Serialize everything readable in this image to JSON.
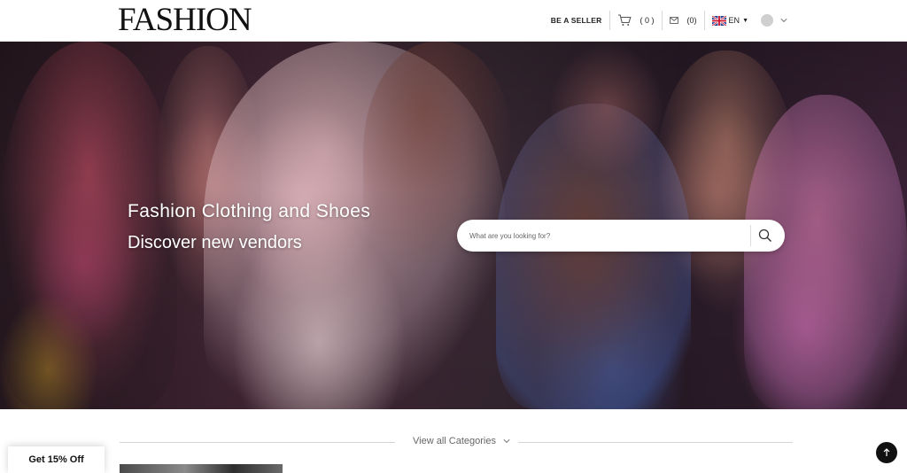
{
  "brand": {
    "logo_text": "FASHION"
  },
  "nav": {
    "seller_label": "BE A SELLER",
    "cart_count": "( 0 )",
    "messages_count": "(0)",
    "language": "EN"
  },
  "hero": {
    "title": "Fashion Clothing and Shoes",
    "subtitle": "Discover new vendors",
    "search_placeholder": "What are you looking for?"
  },
  "categories": {
    "view_all_label": "View all Categories"
  },
  "promo": {
    "label": "Get 15% Off"
  },
  "icons": {
    "cart": "cart-icon",
    "mail": "mail-icon",
    "flag": "uk-flag-icon",
    "search": "search-icon",
    "chevron": "chevron-down-icon",
    "back_to_top": "arrow-up-icon"
  },
  "colors": {
    "accent": "#111111",
    "background": "#ffffff"
  }
}
